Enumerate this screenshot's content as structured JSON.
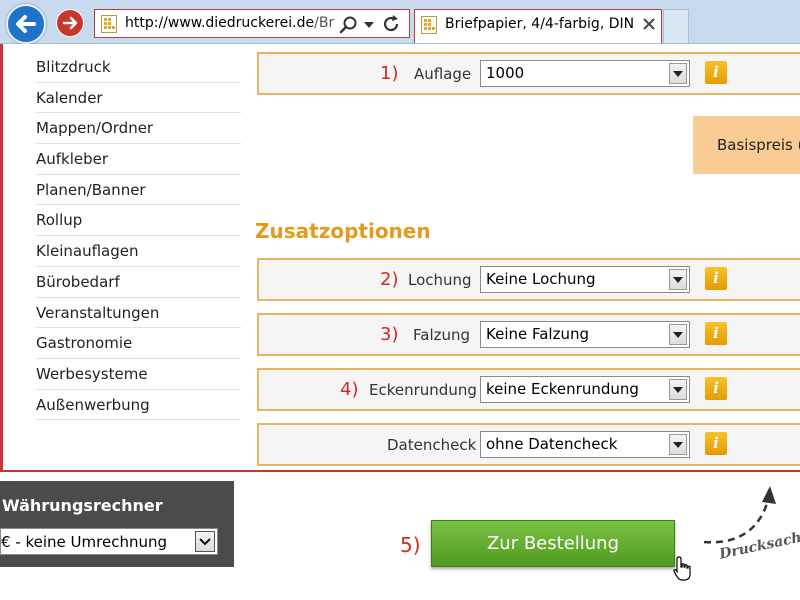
{
  "browser": {
    "address_url_host": "http://www.diedruckerei.de",
    "address_url_path": "/Bri",
    "tab_title": "Briefpapier, 4/4-farbig, DIN..."
  },
  "sidebar": {
    "items": [
      {
        "label": "Blitzdruck"
      },
      {
        "label": "Kalender"
      },
      {
        "label": "Mappen/Ordner"
      },
      {
        "label": "Aufkleber"
      },
      {
        "label": "Planen/Banner"
      },
      {
        "label": "Rollup"
      },
      {
        "label": "Kleinauflagen"
      },
      {
        "label": "Bürobedarf"
      },
      {
        "label": "Veranstaltungen"
      },
      {
        "label": "Gastronomie"
      },
      {
        "label": "Werbesysteme"
      },
      {
        "label": "Außenwerbung"
      }
    ]
  },
  "options": {
    "auflage": {
      "num": "1)",
      "label": "Auflage",
      "value": "1000"
    },
    "zusatz_heading": "Zusatzoptionen",
    "lochung": {
      "num": "2)",
      "label": "Lochung",
      "value": "Keine Lochung"
    },
    "falzung": {
      "num": "3)",
      "label": "Falzung",
      "value": "Keine Falzung"
    },
    "ecken": {
      "num": "4)",
      "label": "Eckenrundung",
      "value": "keine Eckenrundung"
    },
    "datencheck": {
      "label": "Datencheck",
      "value": "ohne Datencheck"
    },
    "info_glyph": "i"
  },
  "basispreis": {
    "label": "Basispreis (n"
  },
  "currency": {
    "title": "Währungsrechner",
    "selected": "€ - keine Umrechnung"
  },
  "order": {
    "step_num": "5)",
    "button_label": "Zur Bestellung"
  },
  "annotation": {
    "text": "Drucksache"
  },
  "colors": {
    "accent_orange": "#e39a1d",
    "border_orange": "#e5b566",
    "step_red": "#d42a1f",
    "order_green": "#5ca82a",
    "browser_blue": "#1e73c8"
  }
}
